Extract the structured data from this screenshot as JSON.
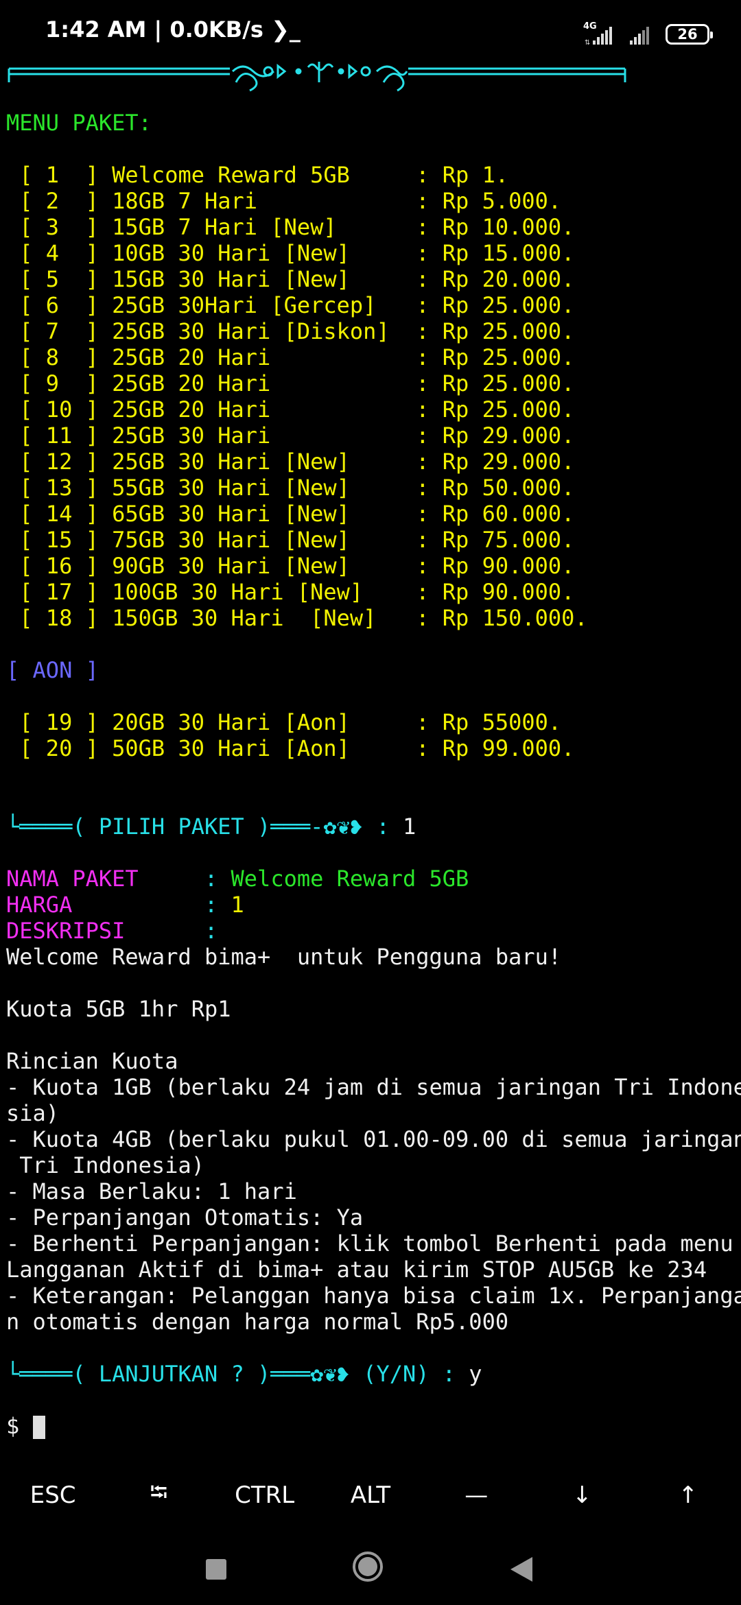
{
  "status_bar": {
    "time_speed": "1:42 AM | 0.0KB/s ❯_",
    "network_type": "4G",
    "battery": "26"
  },
  "terminal": {
    "menu_title": "MENU PAKET:",
    "packages": [
      {
        "num": " 1  ",
        "name": "Welcome Reward 5GB     ",
        "price": "Rp 1."
      },
      {
        "num": " 2  ",
        "name": "18GB 7 Hari            ",
        "price": "Rp 5.000."
      },
      {
        "num": " 3  ",
        "name": "15GB 7 Hari [New]      ",
        "price": "Rp 10.000."
      },
      {
        "num": " 4  ",
        "name": "10GB 30 Hari [New]     ",
        "price": "Rp 15.000."
      },
      {
        "num": " 5  ",
        "name": "15GB 30 Hari [New]     ",
        "price": "Rp 20.000."
      },
      {
        "num": " 6  ",
        "name": "25GB 30Hari [Gercep]   ",
        "price": "Rp 25.000."
      },
      {
        "num": " 7  ",
        "name": "25GB 30 Hari [Diskon]  ",
        "price": "Rp 25.000."
      },
      {
        "num": " 8  ",
        "name": "25GB 20 Hari           ",
        "price": "Rp 25.000."
      },
      {
        "num": " 9  ",
        "name": "25GB 20 Hari           ",
        "price": "Rp 25.000."
      },
      {
        "num": " 10 ",
        "name": "25GB 20 Hari           ",
        "price": "Rp 25.000."
      },
      {
        "num": " 11 ",
        "name": "25GB 30 Hari           ",
        "price": "Rp 29.000."
      },
      {
        "num": " 12 ",
        "name": "25GB 30 Hari [New]     ",
        "price": "Rp 29.000."
      },
      {
        "num": " 13 ",
        "name": "55GB 30 Hari [New]     ",
        "price": "Rp 50.000."
      },
      {
        "num": " 14 ",
        "name": "65GB 30 Hari [New]     ",
        "price": "Rp 60.000."
      },
      {
        "num": " 15 ",
        "name": "75GB 30 Hari [New]     ",
        "price": "Rp 75.000."
      },
      {
        "num": " 16 ",
        "name": "90GB 30 Hari [New]     ",
        "price": "Rp 90.000."
      },
      {
        "num": " 17 ",
        "name": "100GB 30 Hari [New]    ",
        "price": "Rp 90.000."
      },
      {
        "num": " 18 ",
        "name": "150GB 30 Hari  [New]   ",
        "price": "Rp 150.000."
      }
    ],
    "aon_title": "[ AON ]",
    "aon_packages": [
      {
        "num": " 19 ",
        "name": "20GB 30 Hari [Aon]     ",
        "price": "Rp 55000."
      },
      {
        "num": " 20 ",
        "name": "50GB 30 Hari [Aon]     ",
        "price": "Rp 99.000."
      }
    ],
    "pilih_prompt": {
      "label": "PILIH PAKET",
      "value": "1"
    },
    "nama_paket": {
      "label": "NAMA PAKET     ",
      "value": "Welcome Reward 5GB"
    },
    "harga": {
      "label": "HARGA          ",
      "value": "1"
    },
    "deskripsi": {
      "label": "DESKRIPSI      ",
      "value": ""
    },
    "description_lines": [
      "Welcome Reward bima+  untuk Pengguna baru!",
      "",
      "Kuota 5GB 1hr Rp1",
      "",
      "Rincian Kuota",
      "- Kuota 1GB (berlaku 24 jam di semua jaringan Tri Indone",
      "sia)",
      "- Kuota 4GB (berlaku pukul 01.00-09.00 di semua jaringan",
      " Tri Indonesia)",
      "- Masa Berlaku: 1 hari",
      "- Perpanjangan Otomatis: Ya",
      "- Berhenti Perpanjangan: klik tombol Berhenti pada menu",
      "Langganan Aktif di bima+ atau kirim STOP AU5GB ke 234",
      "- Keterangan: Pelanggan hanya bisa claim 1x. Perpanjanga",
      "n otomatis dengan harga normal Rp5.000"
    ],
    "lanjutkan_prompt": {
      "label": "LANJUTKAN ?",
      "options": "(Y/N)",
      "value": "y"
    },
    "shell_prompt": "$ "
  },
  "extra_keys": [
    "ESC",
    "⭾",
    "CTRL",
    "ALT",
    "—",
    "↓",
    "↑"
  ],
  "colors": {
    "background": "#000000",
    "yellow": "#f2f200",
    "green": "#2be62b",
    "cyan": "#28e0e8",
    "magenta": "#f22ff2",
    "blue": "#6b68ff"
  }
}
